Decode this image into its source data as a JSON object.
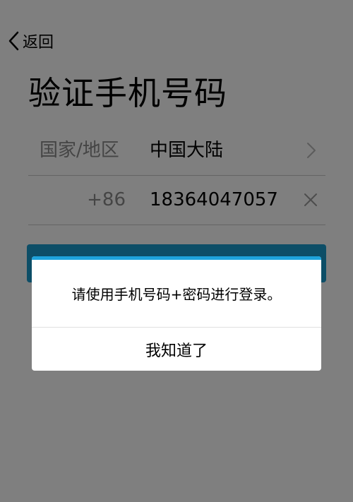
{
  "nav": {
    "back_label": "返回"
  },
  "page": {
    "title": "验证手机号码"
  },
  "form": {
    "country_label": "国家/地区",
    "country_value": "中国大陆",
    "country_code": "+86",
    "phone_value": "18364047057"
  },
  "dialog": {
    "message": "请使用手机号码+密码进行登录。",
    "confirm_label": "我知道了"
  },
  "colors": {
    "accent": "#1ea3dc",
    "overlay": "rgba(0,0,0,0.5)",
    "divider": "#c8c8c8",
    "secondary_text": "#8a8a8a"
  },
  "icons": {
    "back": "chevron-left-icon",
    "country_select": "chevron-right-icon",
    "clear": "close-icon"
  }
}
